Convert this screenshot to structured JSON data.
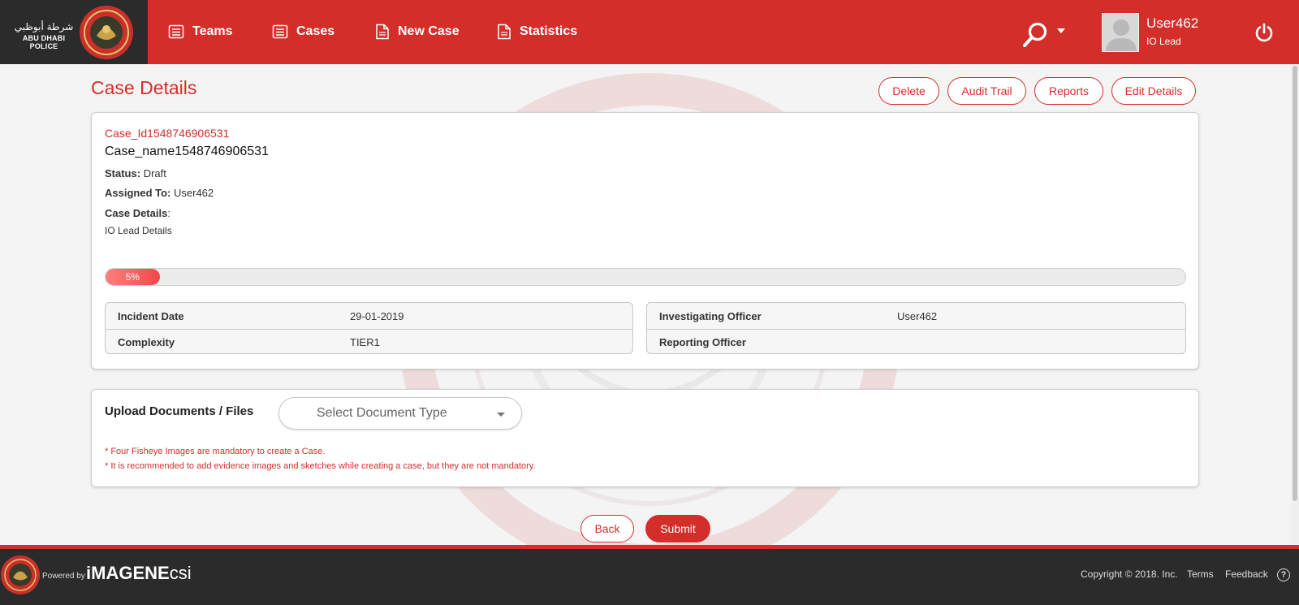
{
  "header": {
    "logo_ar": "شرطة أبوظبي",
    "logo_en": "ABU DHABI POLICE",
    "nav": [
      {
        "label": "Teams",
        "icon": "list-icon"
      },
      {
        "label": "Cases",
        "icon": "list-icon"
      },
      {
        "label": "New Case",
        "icon": "document-icon"
      },
      {
        "label": "Statistics",
        "icon": "document-icon"
      }
    ],
    "user": {
      "name": "User462",
      "role": "IO Lead"
    }
  },
  "page": {
    "title": "Case Details",
    "actions": {
      "delete": "Delete",
      "audit": "Audit Trail",
      "reports": "Reports",
      "edit": "Edit Details"
    }
  },
  "case": {
    "id": "Case_Id1548746906531",
    "name": "Case_name1548746906531",
    "status_label": "Status:",
    "status": "Draft",
    "assigned_label": "Assigned To:",
    "assigned": "User462",
    "details_label": "Case Details",
    "details_colon": ":",
    "details": "IO Lead Details",
    "progress": 5,
    "progress_text": "5%",
    "info_left": [
      {
        "label": "Incident Date",
        "value": "29-01-2019"
      },
      {
        "label": "Complexity",
        "value": "TIER1"
      }
    ],
    "info_right": [
      {
        "label": "Investigating Officer",
        "value": "User462"
      },
      {
        "label": "Reporting Officer",
        "value": ""
      }
    ]
  },
  "upload": {
    "title": "Upload Documents / Files",
    "select_placeholder": "Select Document Type",
    "notes": [
      "* Four Fisheye Images are mandatory to create a Case.",
      "* It is recommended to add evidence images and sketches while creating a case, but they are not mandatory."
    ]
  },
  "buttons": {
    "back": "Back",
    "submit": "Submit"
  },
  "footer": {
    "powered_by": "Powered by",
    "brand_bold": "iMAGENE",
    "brand_rest": "csi",
    "copyright": "Copyright © 2018. Inc.",
    "terms": "Terms",
    "feedback": "Feedback",
    "help": "?"
  },
  "colors": {
    "brand_red": "#d42e2b",
    "dark": "#2b2b2b"
  }
}
